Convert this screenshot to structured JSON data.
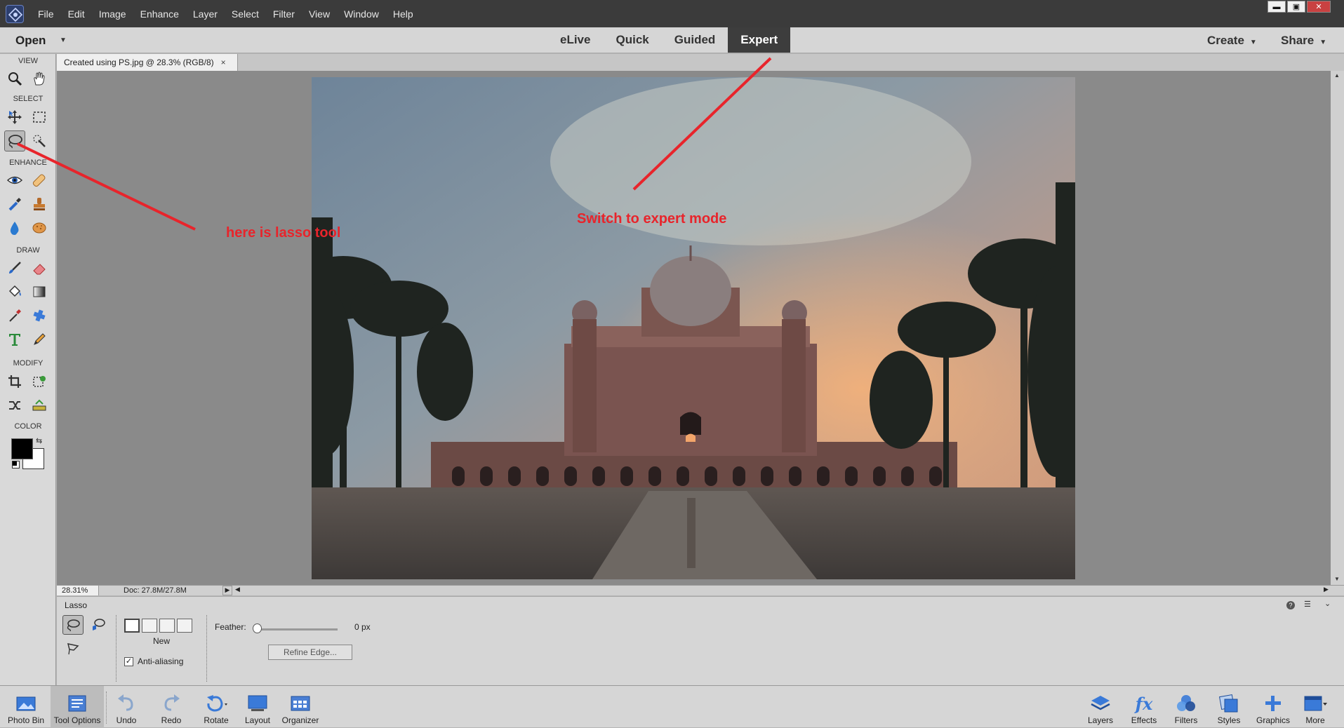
{
  "menu": {
    "items": [
      "File",
      "Edit",
      "Image",
      "Enhance",
      "Layer",
      "Select",
      "Filter",
      "View",
      "Window",
      "Help"
    ]
  },
  "window_controls": {
    "minimize": "▬",
    "maximize": "▣",
    "close": "✕"
  },
  "modebar": {
    "open_label": "Open",
    "tabs": [
      {
        "label": "eLive",
        "active": false
      },
      {
        "label": "Quick",
        "active": false
      },
      {
        "label": "Guided",
        "active": false
      },
      {
        "label": "Expert",
        "active": true
      }
    ],
    "create_label": "Create",
    "share_label": "Share"
  },
  "toolbox": {
    "sections": {
      "view": "VIEW",
      "select": "SELECT",
      "enhance": "ENHANCE",
      "draw": "DRAW",
      "modify": "MODIFY",
      "color": "COLOR"
    },
    "active_tool": "lasso"
  },
  "document": {
    "tab_title": "Created using PS.jpg @ 28.3% (RGB/8)",
    "close_symbol": "×"
  },
  "status": {
    "zoom": "28.31%",
    "doc_info": "Doc: 27.8M/27.8M"
  },
  "tool_options": {
    "title": "Lasso",
    "mode_label": "New",
    "anti_aliasing_label": "Anti-aliasing",
    "anti_aliasing_checked": true,
    "feather_label": "Feather:",
    "feather_value": "0 px",
    "refine_edge_label": "Refine Edge..."
  },
  "taskbar": {
    "left": [
      {
        "label": "Photo Bin",
        "icon": "photo-bin-icon"
      },
      {
        "label": "Tool Options",
        "icon": "tool-options-icon",
        "active": true
      },
      {
        "label": "Undo",
        "icon": "undo-icon"
      },
      {
        "label": "Redo",
        "icon": "redo-icon"
      },
      {
        "label": "Rotate",
        "icon": "rotate-icon"
      },
      {
        "label": "Layout",
        "icon": "layout-icon"
      },
      {
        "label": "Organizer",
        "icon": "organizer-icon"
      }
    ],
    "right": [
      {
        "label": "Layers",
        "icon": "layers-icon"
      },
      {
        "label": "Effects",
        "icon": "effects-icon"
      },
      {
        "label": "Filters",
        "icon": "filters-icon"
      },
      {
        "label": "Styles",
        "icon": "styles-icon"
      },
      {
        "label": "Graphics",
        "icon": "graphics-icon"
      },
      {
        "label": "More",
        "icon": "more-icon"
      }
    ]
  },
  "annotations": {
    "lasso_note": "here is lasso tool",
    "expert_note": "Switch to expert mode",
    "color": "#e8242b"
  }
}
